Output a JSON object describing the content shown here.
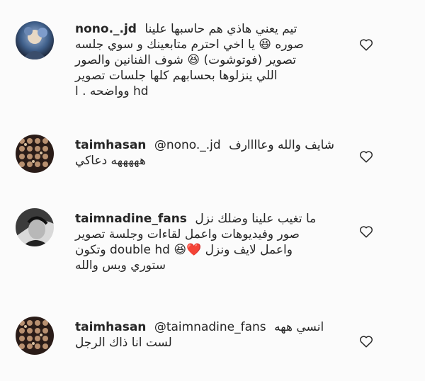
{
  "comments": [
    {
      "username": "nono._.jd",
      "lines": [
        "تيم يعني هاذي هم حاسبها علينا",
        "صوره 😆 يا اخي احترم متابعينك و سوي جلسه",
        "تصوير (فوتوشوت) 😆 شوف الفنانين والصور",
        "اللي ينزلوها بحسابهم كلها جلسات تصوير",
        "hd وواضحه . ا"
      ],
      "avatar_icon": "profile-avatar-blue"
    },
    {
      "username": "taimhasan",
      "mention": "@nono._.jd",
      "lines": [
        "شايف والله وعاااارف",
        "هههههه دعاكي"
      ],
      "avatar_icon": "profile-avatar-mosaic"
    },
    {
      "username": "taimnadine_fans",
      "lines": [
        "ما تغيب علينا وضلك نزل",
        "صور وفيديوهات واعمل لقاءات وجلسة تصوير",
        "واعمل لايف ونزل ❤️😆 double hd وتكون",
        "ستوري وبس والله"
      ],
      "avatar_icon": "profile-avatar-bw"
    },
    {
      "username": "taimhasan",
      "mention": "@taimnadine_fans",
      "lines": [
        "انسي ههه",
        "لست انا ذاك الرجل"
      ],
      "avatar_icon": "profile-avatar-mosaic"
    }
  ],
  "like_icon": "heart-outline-icon",
  "colors": {
    "text": "#262626",
    "heart_stroke": "#262626",
    "background": "#fbfbfb"
  }
}
